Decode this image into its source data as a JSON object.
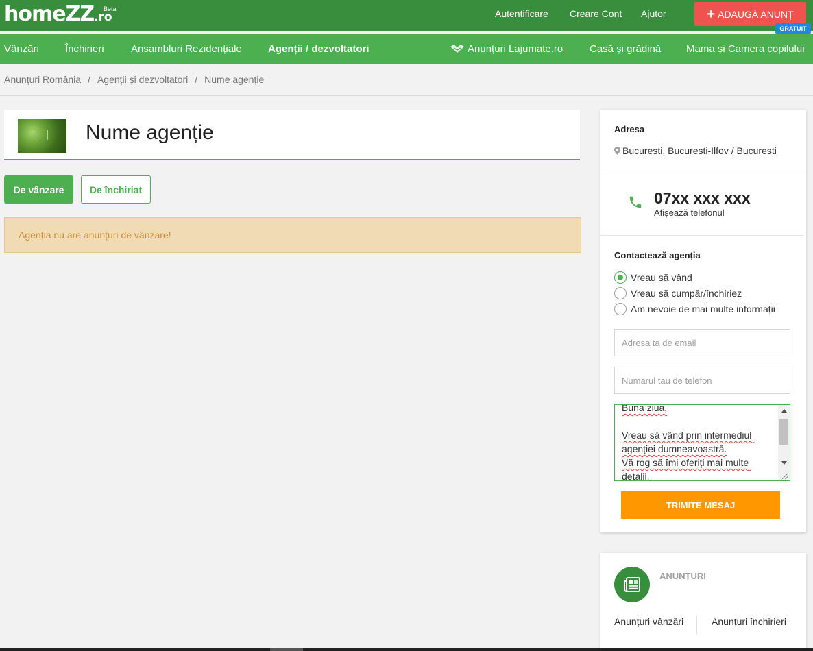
{
  "header": {
    "logo_main": "homeZZ",
    "logo_tld": ".ro",
    "logo_beta": "Beta",
    "links": {
      "login": "Autentificare",
      "register": "Creare Cont",
      "help": "Ajutor"
    },
    "add_button": {
      "plus": "+",
      "label": "ADAUGĂ ANUNȚ",
      "badge": "GRATUIT"
    }
  },
  "nav": {
    "items": [
      "Vânzări",
      "Închirieri",
      "Ansambluri Rezidențiale",
      "Agenții / dezvoltatori"
    ],
    "active": "Agenții / dezvoltatori",
    "right_items": [
      "Anunțuri Lajumate.ro",
      "Casă și grădină",
      "Mama și Camera copilului"
    ]
  },
  "breadcrumb": [
    "Anunțuri România",
    "Agenții și dezvoltatori",
    "Nume agenție"
  ],
  "breadcrumb_separator": "/",
  "agency": {
    "name": "Nume agenție"
  },
  "tabs": {
    "sale": "De vânzare",
    "rent": "De închiriat",
    "active": "sale"
  },
  "notice": "Agenția nu are anunțuri de vânzare!",
  "sidebar": {
    "address_title": "Adresa",
    "address": "Bucuresti, Bucuresti-Ilfov / Bucuresti",
    "phone": "07xx xxx xxx",
    "phone_action": "Afișează telefonul",
    "contact_title": "Contactează agenția",
    "options": [
      "Vreau să vând",
      "Vreau să cumpăr/închiriez",
      "Am nevoie de mai multe informații"
    ],
    "selected_option": "Vreau să vând",
    "email_placeholder": "Adresa ta de email",
    "phone_placeholder": "Numarul tau de telefon",
    "message": "Buna ziua,\n\nVreau să vând prin intermediul agenției dumneavoastră.\nVă rog să îmi oferiți mai multe detalii.",
    "send_label": "TRIMITE MESAJ"
  },
  "listings": {
    "title": "ANUNȚURI",
    "sale_link": "Anunțuri vânzări",
    "rent_link": "Anunțuri închirieri"
  },
  "colors": {
    "header_green": "#388e3c",
    "nav_green": "#4caf50",
    "add_red": "#ef5350",
    "badge_blue": "#1e88e5",
    "send_orange": "#ff9800",
    "notice_bg": "#f0dbb4"
  },
  "icons": [
    "heart-handshake-icon",
    "map-pin-icon",
    "phone-icon",
    "newspaper-icon",
    "plus-icon"
  ]
}
